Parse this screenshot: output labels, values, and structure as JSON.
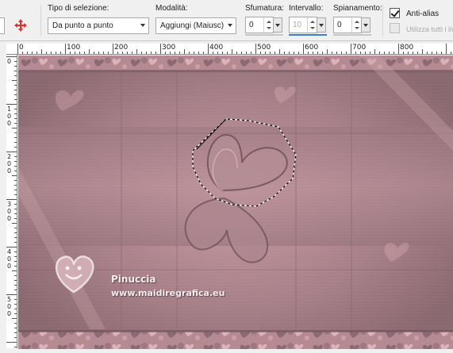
{
  "toolbar": {
    "selection_type": {
      "label": "Tipo di selezione:",
      "value": "Da punto a punto"
    },
    "mode": {
      "label": "Modalità:",
      "value": "Aggiungi (Maiusc)"
    },
    "feather": {
      "label": "Sfumatura:",
      "value": "0"
    },
    "interval": {
      "label": "Intervallo:",
      "value": "10"
    },
    "smoothing": {
      "label": "Spianamento:",
      "value": "0"
    },
    "anti_alias": {
      "label": "Anti-alias",
      "checked": true
    },
    "use_all_layers": {
      "label": "Utilizza tutti i liv",
      "checked": false,
      "enabled": false
    },
    "move_icon": "move-cross-icon"
  },
  "ruler": {
    "h_labels": [
      "0",
      "100",
      "200",
      "300",
      "400",
      "500",
      "600",
      "700",
      "800"
    ],
    "v_labels": [
      "0",
      "100",
      "200",
      "300",
      "400",
      "500"
    ]
  },
  "watermark": {
    "name": "Pinuccia",
    "site": "www.maidiregrafica.eu",
    "logo_icon": "heart-smiley-logo-icon"
  },
  "colors": {
    "canvas": "#a67f87",
    "selection_marquee": "#000000",
    "active_field_underline": "#3a7fd0"
  }
}
